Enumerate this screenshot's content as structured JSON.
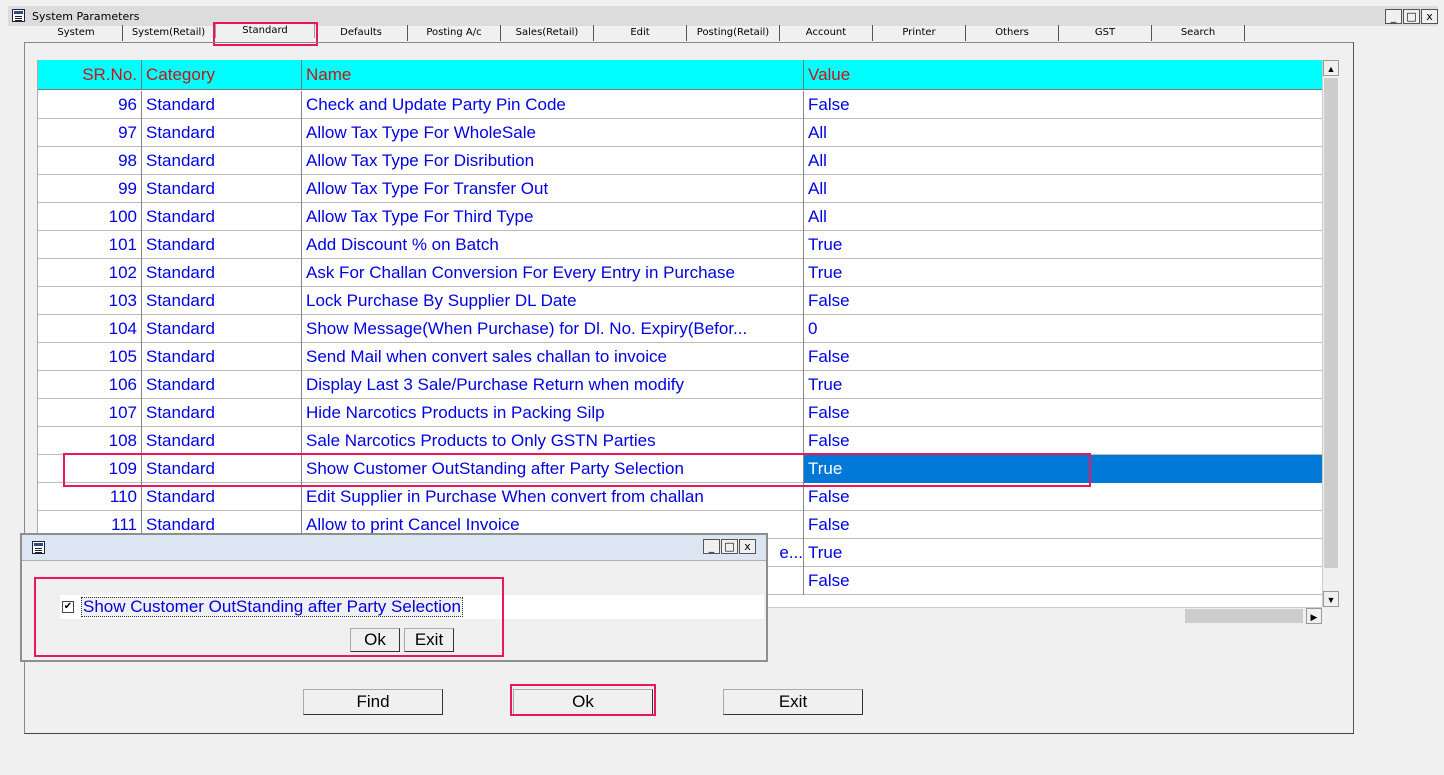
{
  "window": {
    "title": "System Parameters",
    "controls": [
      "_",
      "□",
      "x"
    ]
  },
  "tabs": [
    "System",
    "System(Retail)",
    "Standard",
    "Defaults",
    "Posting A/c",
    "Sales(Retail)",
    "Edit",
    "Posting(Retail)",
    "Account",
    "Printer",
    "Others",
    "GST",
    "Search"
  ],
  "active_tab": "Standard",
  "grid": {
    "headers": [
      "SR.No.",
      "Category",
      "Name",
      "Value"
    ],
    "rows": [
      {
        "sr": "96",
        "cat": "Standard",
        "name": "Check and Update Party Pin Code",
        "value": "False"
      },
      {
        "sr": "97",
        "cat": "Standard",
        "name": "Allow Tax Type For WholeSale",
        "value": "All"
      },
      {
        "sr": "98",
        "cat": "Standard",
        "name": "Allow Tax Type For Disribution",
        "value": "All"
      },
      {
        "sr": "99",
        "cat": "Standard",
        "name": "Allow Tax Type For Transfer Out",
        "value": "All"
      },
      {
        "sr": "100",
        "cat": "Standard",
        "name": "Allow Tax Type For Third Type",
        "value": "All"
      },
      {
        "sr": "101",
        "cat": "Standard",
        "name": "Add Discount % on Batch",
        "value": "True"
      },
      {
        "sr": "102",
        "cat": "Standard",
        "name": "Ask For Challan Conversion For Every Entry in Purchase",
        "value": "True"
      },
      {
        "sr": "103",
        "cat": "Standard",
        "name": "Lock Purchase By Supplier DL Date",
        "value": "False"
      },
      {
        "sr": "104",
        "cat": "Standard",
        "name": "Show Message(When Purchase) for Dl. No. Expiry(Befor...",
        "value": "0"
      },
      {
        "sr": "105",
        "cat": "Standard",
        "name": "Send Mail when convert sales challan to invoice",
        "value": "False"
      },
      {
        "sr": "106",
        "cat": "Standard",
        "name": "Display Last 3 Sale/Purchase Return when modify",
        "value": "True"
      },
      {
        "sr": "107",
        "cat": "Standard",
        "name": "Hide Narcotics Products in Packing Silp",
        "value": "False"
      },
      {
        "sr": "108",
        "cat": "Standard",
        "name": "Sale Narcotics Products to Only GSTN Parties",
        "value": "False"
      },
      {
        "sr": "109",
        "cat": "Standard",
        "name": "Show Customer OutStanding after Party Selection",
        "value": "True"
      },
      {
        "sr": "110",
        "cat": "Standard",
        "name": "Edit Supplier in Purchase When convert from challan",
        "value": "False"
      },
      {
        "sr": "111",
        "cat": "Standard",
        "name": "Allow to print Cancel Invoice",
        "value": "False"
      },
      {
        "sr": "",
        "cat": "",
        "name": "e...",
        "value": "True"
      },
      {
        "sr": "",
        "cat": "",
        "name": "",
        "value": "False"
      }
    ],
    "selected_sr": "109"
  },
  "buttons": {
    "find": "Find",
    "ok": "Ok",
    "exit": "Exit"
  },
  "dialog": {
    "title": "",
    "checkbox_label": "Show Customer OutStanding after Party Selection",
    "checked": true,
    "check_mark": "✔",
    "ok": "Ok",
    "exit": "Exit"
  },
  "colors": {
    "header_bg": "#00ffff",
    "header_text": "#c81414",
    "row_text": "#0000e0",
    "selection": "#0078d7",
    "highlight_box": "#e8185a"
  }
}
